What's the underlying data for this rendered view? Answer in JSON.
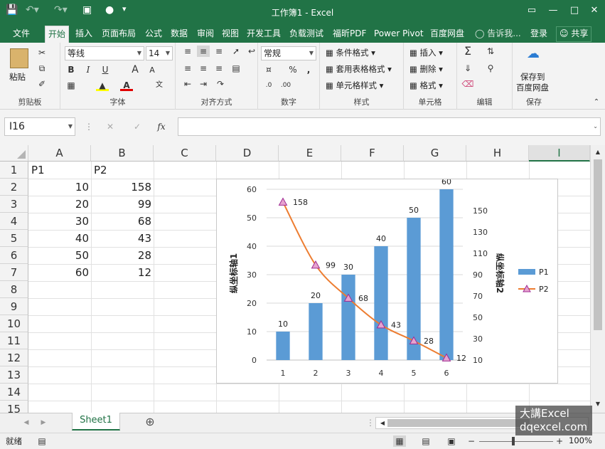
{
  "window": {
    "title": "工作簿1 - Excel"
  },
  "ribbon_tabs": [
    "文件",
    "开始",
    "插入",
    "页面布局",
    "公式",
    "数据",
    "审阅",
    "视图",
    "开发工具",
    "负载测试",
    "福昕PDF",
    "Power Pivot",
    "百度网盘"
  ],
  "tell_me": "告诉我...",
  "login": "登录",
  "share": "共享",
  "groups": {
    "clipboard": {
      "label": "剪贴板",
      "paste": "粘贴"
    },
    "font": {
      "label": "字体",
      "name": "等线",
      "size": "14",
      "bold": "B",
      "italic": "I",
      "underline": "U",
      "grow": "A",
      "shrink": "A"
    },
    "align": {
      "label": "对齐方式"
    },
    "number": {
      "label": "数字",
      "format": "常规",
      "percent": "%",
      "comma": ","
    },
    "styles": {
      "label": "样式",
      "cond": "条件格式",
      "table": "套用表格格式",
      "cell": "单元格样式"
    },
    "cells": {
      "label": "单元格",
      "insert": "插入",
      "delete": "删除",
      "format": "格式"
    },
    "editing": {
      "label": "编辑"
    },
    "save": {
      "label": "保存",
      "save_to_1": "保存到",
      "save_to_2": "百度网盘"
    }
  },
  "formula_bar": {
    "name_box": "I16",
    "fx": "fx"
  },
  "columns": [
    "A",
    "B",
    "C",
    "D",
    "E",
    "F",
    "G",
    "H",
    "I"
  ],
  "rows": [
    "1",
    "2",
    "3",
    "4",
    "5",
    "6",
    "7",
    "8",
    "9",
    "10",
    "11",
    "12",
    "13",
    "14",
    "15"
  ],
  "cells": {
    "A1": "P1",
    "B1": "P2",
    "A2": "10",
    "B2": "158",
    "A3": "20",
    "B3": "99",
    "A4": "30",
    "B4": "68",
    "A5": "40",
    "B5": "43",
    "A6": "50",
    "B6": "28",
    "A7": "60",
    "B7": "12"
  },
  "chart_data": {
    "type": "bar",
    "categories": [
      "1",
      "2",
      "3",
      "4",
      "5",
      "6"
    ],
    "series": [
      {
        "name": "P1",
        "type": "bar",
        "axis": "left",
        "values": [
          10,
          20,
          30,
          40,
          50,
          60
        ],
        "color": "#5b9bd5"
      },
      {
        "name": "P2",
        "type": "line",
        "axis": "right",
        "values": [
          158,
          99,
          68,
          43,
          28,
          12
        ],
        "color": "#ed7d31",
        "marker_color": "#a02b93"
      }
    ],
    "ylabel": "纵坐标轴1",
    "y2label": "纵坐标轴2",
    "ylim": [
      0,
      60
    ],
    "yticks": [
      0,
      10,
      20,
      30,
      40,
      50,
      60
    ],
    "y2lim": [
      10,
      170
    ],
    "y2ticks": [
      10,
      30,
      50,
      70,
      90,
      110,
      130,
      150
    ],
    "grid": true,
    "legend": "right"
  },
  "sheet_tab": "Sheet1",
  "status": {
    "ready": "就绪",
    "zoom": "100%"
  },
  "watermark": {
    "line1": "大講Excel",
    "line2": "dqexcel.com"
  }
}
